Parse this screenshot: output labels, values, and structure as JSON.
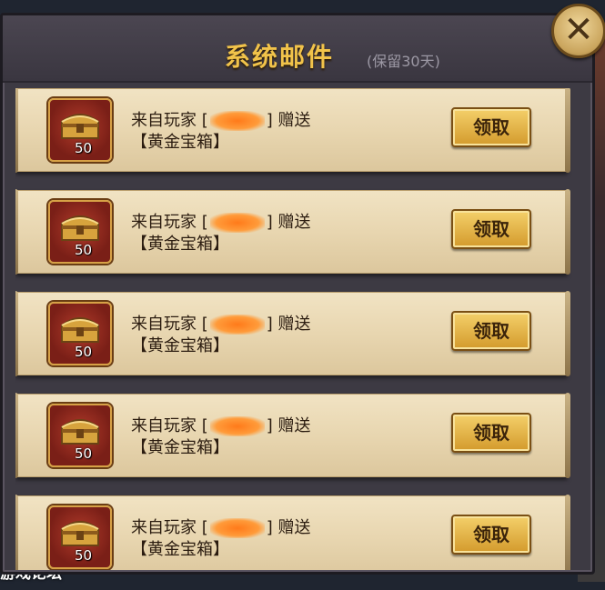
{
  "dialog": {
    "title": "系统邮件",
    "subtitle": "(保留30天)",
    "close_icon": "close-icon"
  },
  "mails": [
    {
      "line1_prefix": "来自玩家 [",
      "line1_suffix": "] 赠送",
      "item_name": "【黄金宝箱】",
      "qty": "50",
      "button": "领取",
      "icon": "treasure-chest-icon"
    },
    {
      "line1_prefix": "来自玩家 [",
      "line1_suffix": "] 赠送",
      "item_name": "【黄金宝箱】",
      "qty": "50",
      "button": "领取",
      "icon": "treasure-chest-icon"
    },
    {
      "line1_prefix": "来自玩家 [",
      "line1_suffix": "] 赠送",
      "item_name": "【黄金宝箱】",
      "qty": "50",
      "button": "领取",
      "icon": "treasure-chest-icon"
    },
    {
      "line1_prefix": "来自玩家 [",
      "line1_suffix": "] 赠送",
      "item_name": "【黄金宝箱】",
      "qty": "50",
      "button": "领取",
      "icon": "treasure-chest-icon"
    },
    {
      "line1_prefix": "来自玩家 [",
      "line1_suffix": "] 赠送",
      "item_name": "【黄金宝箱】",
      "qty": "50",
      "button": "领取",
      "icon": "treasure-chest-icon"
    }
  ],
  "background": {
    "bottom_text": "游戏论坛"
  }
}
